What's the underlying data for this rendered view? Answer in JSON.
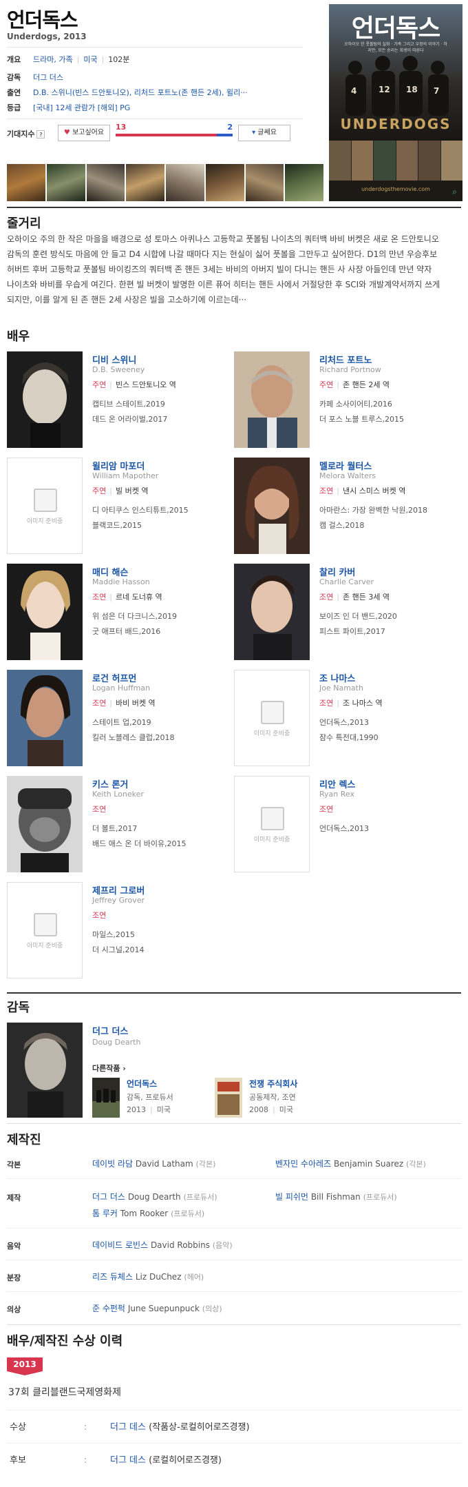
{
  "movie": {
    "title": "언더독스",
    "subtitle": "Underdogs, 2013"
  },
  "info": {
    "overview_label": "개요",
    "genre": "드라마, 가족",
    "country": "미국",
    "runtime": "102분",
    "director_label": "감독",
    "director": "더그 더스",
    "cast_label": "출연",
    "cast_text": "D.B. 스위니(빈스 드안토니오), 리처드 포트노(존 핸든 2세), 윌리···",
    "rating_label": "등급",
    "rating_text": "[국내] 12세 관람가 [해외] PG"
  },
  "expectation": {
    "label": "기대지수",
    "help": "?",
    "want_button": "보고싶어요",
    "want_count": "13",
    "dislike_count": "2",
    "want_ratio": 0.8667,
    "dislike_button": "글쎄요"
  },
  "poster": {
    "title": "언더독스",
    "tagline": "오하이오 한 풋볼팀의 실화 · 가족 그리고 우정의 이야기 · 하지만, 모든 승리는 희생이 따른다",
    "english_title": "UNDERDOGS",
    "url": "underdogsthemovie.com"
  },
  "sections": {
    "synopsis": "줄거리",
    "cast": "배우",
    "director": "감독",
    "crew": "제작진",
    "awards": "배우/제작진 수상 이력"
  },
  "synopsis": "오하이오 주의 한 작은 마을을 배경으로 성 토마스 아퀴나스 고등학교 풋볼팀 나이츠의 쿼터백 바비 버켓은 새로 온 드안토니오 감독의 훈련 방식도 마음에 안 들고 D4 시합에 나갈 때마다 지는 현실이 싫어 풋볼을 그만두고 싶어한다. D1의 만년 우승후보 허버트 후버 고등학교 풋볼팀 바이킹즈의 쿼터백 존 핸든 3세는 바비의 아버지 빌이 다니는 핸든 사 사장 아들인데 만년 약자 나이츠와 바비를 우습게 여긴다. 한편 빌 버켓이 발명한 이른 퓨어 히터는 핸든 사에서 거절당한 후 SCI와 개발계약서까지 쓰게 되지만, 이를 알게 된 존 핸든 2세 사장은 빌을 고소하기에 이르는데···",
  "cast_list": [
    {
      "name": "디비 스위니",
      "ename": "D.B. Sweeney",
      "type": "주연",
      "role": "빈스 드안토니오 역",
      "work1": "캡티브 스테이트,2019",
      "work2": "데드 온 어라이벌,2017",
      "photo": "p1"
    },
    {
      "name": "리처드 포트노",
      "ename": "Richard Portnow",
      "type": "주연",
      "role": "존 핸든 2세 역",
      "work1": "카페 소사이어티,2016",
      "work2": "더 포스 노블 트루스,2015",
      "photo": "p2"
    },
    {
      "name": "윌리암 마포더",
      "ename": "William Mapother",
      "type": "주연",
      "role": "빌 버켓 역",
      "work1": "디 아티쿠스 인스티튜트,2015",
      "work2": "블랙코드,2015",
      "photo": ""
    },
    {
      "name": "멜로라 월터스",
      "ename": "Melora Walters",
      "type": "조연",
      "role": "낸시 스미스 버켓 역",
      "work1": "아마란스: 가장 완벽한 낙원,2018",
      "work2": "캠 걸스,2018",
      "photo": "p4"
    },
    {
      "name": "매디 해슨",
      "ename": "Maddie Hasson",
      "type": "조연",
      "role": "르네 도너휴 역",
      "work1": "위 섬은 더 다크니스,2019",
      "work2": "굿 애프터 배드,2016",
      "photo": "p5"
    },
    {
      "name": "찰리 카버",
      "ename": "Charlie Carver",
      "type": "조연",
      "role": "존 핸든 3세 역",
      "work1": "보이즈 인 더 밴드,2020",
      "work2": "피스트 파이트,2017",
      "photo": "p6"
    },
    {
      "name": "로건 허프먼",
      "ename": "Logan Huffman",
      "type": "조연",
      "role": "바비 버켓 역",
      "work1": "스테이트 업,2019",
      "work2": "킬러 노블레스 클럽,2018",
      "photo": "p7"
    },
    {
      "name": "조 나마스",
      "ename": "Joe Namath",
      "type": "조연",
      "role": "조 나마스 역",
      "work1": "언더독스,2013",
      "work2": "잠수 특전대,1990",
      "photo": ""
    },
    {
      "name": "키스 론거",
      "ename": "Keith Loneker",
      "type": "조연",
      "role": "",
      "work1": "더 볼트,2017",
      "work2": "배드 애스 온 더 바이유,2015",
      "photo": "p9"
    },
    {
      "name": "리안 렉스",
      "ename": "Ryan Rex",
      "type": "조연",
      "role": "",
      "work1": "언더독스,2013",
      "work2": "",
      "photo": ""
    },
    {
      "name": "제프리 그로버",
      "ename": "Jeffrey Grover",
      "type": "조연",
      "role": "",
      "work1": "마일스,2015",
      "work2": "더 시그널,2014",
      "photo": ""
    }
  ],
  "no_image_text": "이미지 준비중",
  "director": {
    "name": "더그 더스",
    "ename": "Doug Dearth",
    "other_label": "다른작품 ›",
    "works": [
      {
        "title": "언더독스",
        "role": "감독, 프로듀서",
        "year": "2013",
        "country": "미국"
      },
      {
        "title": "전쟁 주식회사",
        "role": "공동제작, 조연",
        "year": "2008",
        "country": "미국"
      }
    ]
  },
  "crew": [
    {
      "label": "각본",
      "items": [
        {
          "kname": "데이빗 라담",
          "ename": "David Latham",
          "role": "(각본)"
        },
        {
          "kname": "벤자민 수아레즈",
          "ename": "Benjamin Suarez",
          "role": "(각본)"
        }
      ]
    },
    {
      "label": "제작",
      "items": [
        {
          "kname": "더그 더스",
          "ename": "Doug Dearth",
          "role": "(프로듀서)"
        },
        {
          "kname": "빌 피쉬먼",
          "ename": "Bill Fishman",
          "role": "(프로듀서)"
        },
        {
          "kname": "톰 루커",
          "ename": "Tom Rooker",
          "role": "(프로듀서)"
        }
      ]
    },
    {
      "label": "음악",
      "items": [
        {
          "kname": "데이비드 로빈스",
          "ename": "David Robbins",
          "role": "(음악)"
        }
      ]
    },
    {
      "label": "분장",
      "items": [
        {
          "kname": "리즈 듀체스",
          "ename": "Liz DuChez",
          "role": "(헤어)"
        }
      ]
    },
    {
      "label": "의상",
      "items": [
        {
          "kname": "준 수펀퍽",
          "ename": "June Suepunpuck",
          "role": "(의상)"
        }
      ]
    }
  ],
  "awards": {
    "year": "2013",
    "festival": "37회 클리블랜드국제영화제",
    "rows": [
      {
        "kind": "수상",
        "colon": ":",
        "name": "더그 데스",
        "detail": " (작품상-로컬히어로즈경쟁)"
      },
      {
        "kind": "후보",
        "colon": ":",
        "name": "더그 데스",
        "detail": " (로컬히어로즈경쟁)"
      }
    ]
  },
  "colors": {
    "accent_red": "#d8354e",
    "link_blue": "#1a55a8",
    "bar_blue": "#2a5ac8"
  }
}
